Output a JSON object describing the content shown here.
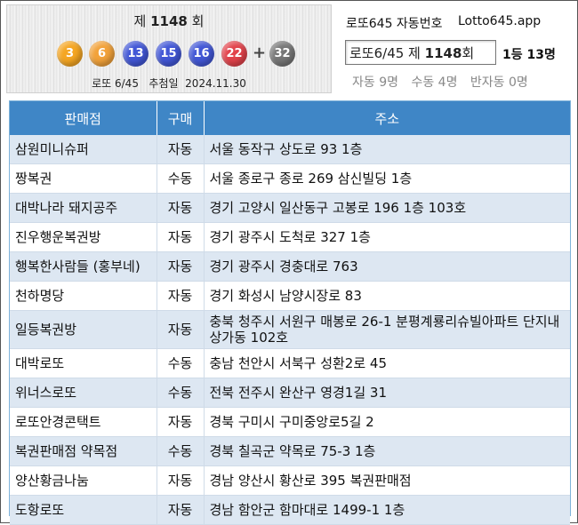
{
  "draw": {
    "round_prefix": "제",
    "round_number": "1148",
    "round_suffix": "회",
    "balls": [
      {
        "number": "3",
        "color": "#f5a623"
      },
      {
        "number": "6",
        "color": "#f2a23a"
      },
      {
        "number": "13",
        "color": "#4257d6"
      },
      {
        "number": "15",
        "color": "#4257d6"
      },
      {
        "number": "16",
        "color": "#4257d6"
      },
      {
        "number": "22",
        "color": "#e2434b"
      }
    ],
    "plus": "+",
    "bonus": {
      "number": "32",
      "color": "#777777"
    },
    "game_label": "로또 6/45",
    "date_label": "추첨일",
    "date": "2024.11.30"
  },
  "header": {
    "title": "로또645 자동번호",
    "domain": "Lotto645.app",
    "round_field_prefix": "로또6/45 제",
    "round_field_number": "1148",
    "round_field_suffix": "회",
    "first_prize": "1등 13명",
    "stats": [
      "자동 9명",
      "수동 4명",
      "반자동 0명"
    ]
  },
  "table": {
    "columns": [
      "판매점",
      "구매",
      "주소"
    ],
    "rows": [
      {
        "store": "삼원미니슈퍼",
        "type": "자동",
        "address": "서울 동작구 상도로 93 1층"
      },
      {
        "store": "짱복권",
        "type": "수동",
        "address": "서울 종로구 종로 269 삼신빌딩 1층"
      },
      {
        "store": "대박나라 돼지공주",
        "type": "자동",
        "address": "경기 고양시 일산동구 고봉로 196 1층 103호"
      },
      {
        "store": "진우행운복권방",
        "type": "자동",
        "address": "경기 광주시 도척로 327 1층"
      },
      {
        "store": "행복한사람들 (홍부네)",
        "type": "자동",
        "address": "경기 광주시 경충대로 763"
      },
      {
        "store": "천하명당",
        "type": "자동",
        "address": "경기 화성시 남양시장로 83"
      },
      {
        "store": "일등복권방",
        "type": "자동",
        "address": "충북 청주시 서원구 매봉로 26-1 분평계룡리슈빌아파트 단지내 상가동 102호"
      },
      {
        "store": "대박로또",
        "type": "수동",
        "address": "충남 천안시 서북구 성환2로 45"
      },
      {
        "store": "위너스로또",
        "type": "수동",
        "address": "전북 전주시 완산구 영경1길 31"
      },
      {
        "store": "로또안경콘택트",
        "type": "자동",
        "address": "경북 구미시 구미중앙로5길 2"
      },
      {
        "store": "복권판매점 약목점",
        "type": "수동",
        "address": "경북 칠곡군 약목로 75-3 1층"
      },
      {
        "store": "양산황금나눔",
        "type": "자동",
        "address": "경남 양산시 황산로 395 복권판매점"
      },
      {
        "store": "도항로또",
        "type": "자동",
        "address": "경남 함안군 함마대로 1499-1 1층"
      }
    ]
  }
}
